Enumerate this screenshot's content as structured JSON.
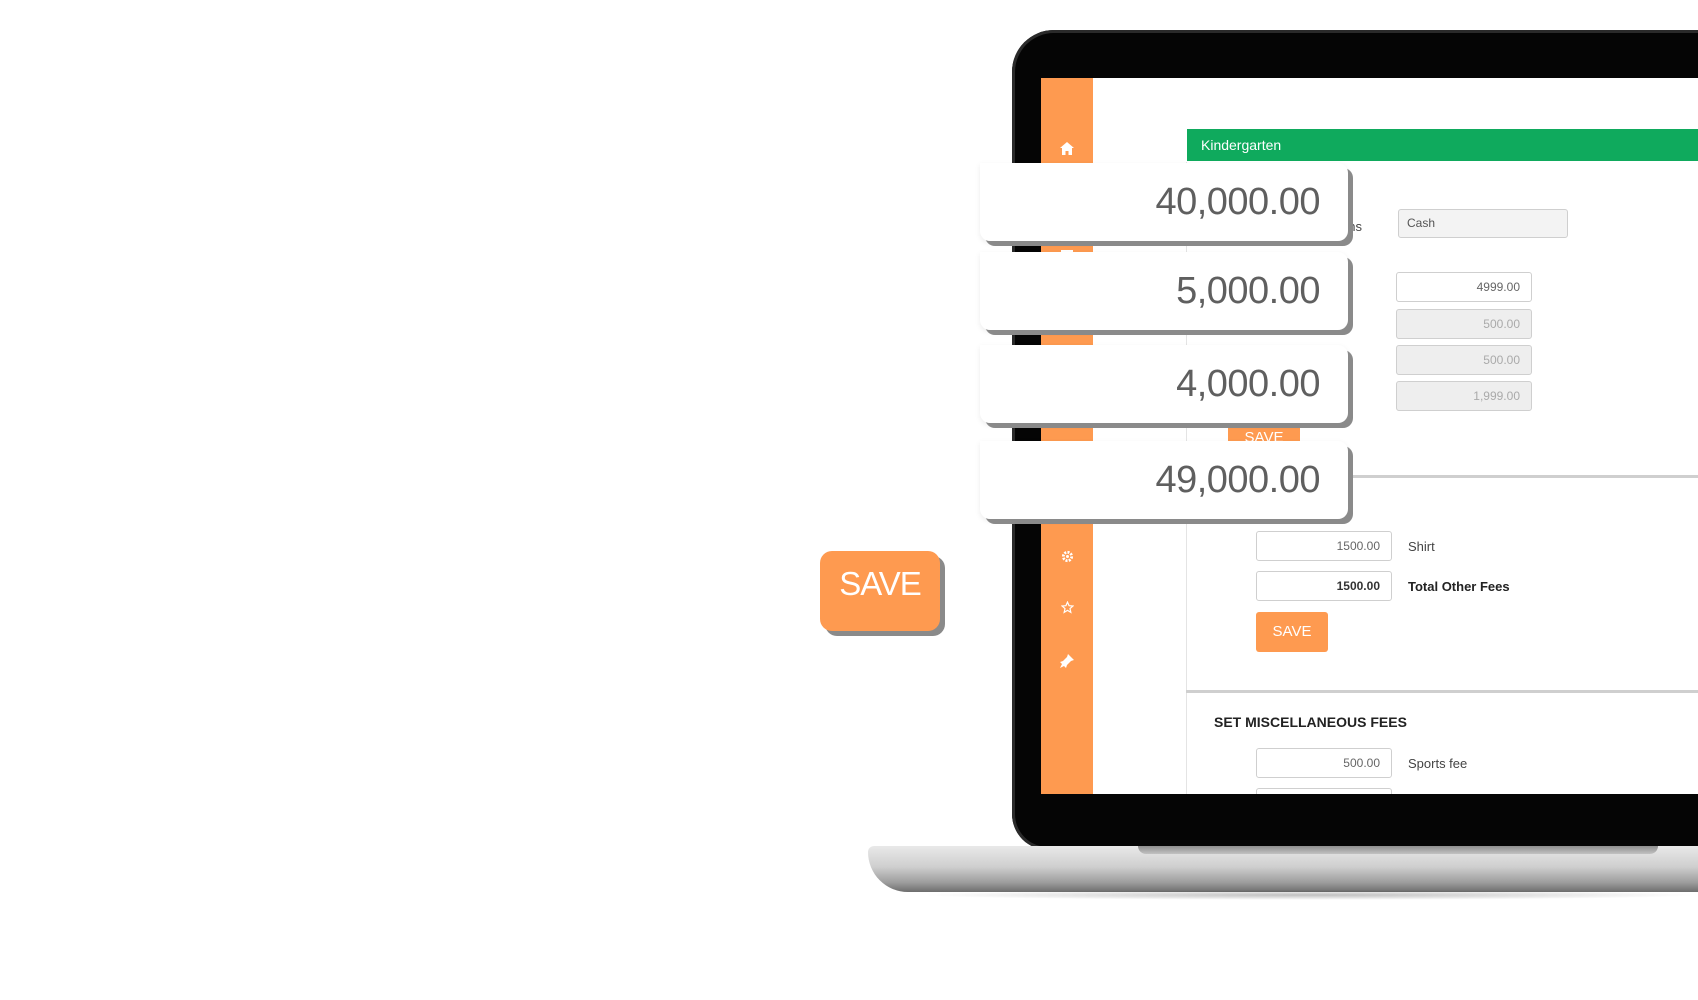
{
  "app": {
    "grade_title": "Kindergarten",
    "payment": {
      "label_fragment": "ons",
      "select_value": "Cash"
    },
    "tuition_inputs": [
      "4999.00",
      "500.00",
      "500.00",
      "1,999.00"
    ],
    "tuition_save_label": "SAVE",
    "other_fees": {
      "rows": [
        {
          "value": "1500.00",
          "label": "Shirt"
        },
        {
          "value": "1500.00",
          "label": "Total Other Fees"
        }
      ],
      "save_label": "SAVE"
    },
    "misc_fees": {
      "heading": "SET MISCELLANEOUS FEES",
      "rows": [
        {
          "value": "500.00",
          "label": "Sports fee"
        }
      ]
    },
    "sidebar_icons": [
      "home-icon",
      "document-icon",
      "gear-icon",
      "star-icon",
      "pin-icon"
    ]
  },
  "callouts": {
    "amounts": [
      "40,000.00",
      "5,000.00",
      "4,000.00",
      "49,000.00"
    ],
    "save_label": "SAVE"
  },
  "colors": {
    "accent_orange": "#fe9a50",
    "header_green": "#0faa5d"
  }
}
